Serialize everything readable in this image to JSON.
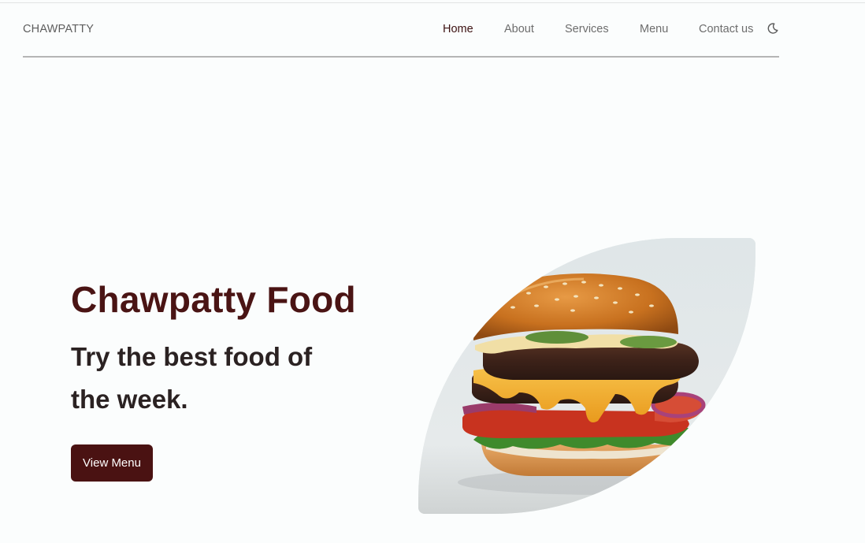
{
  "brand": {
    "logo": "CHAWPATTY",
    "accent_color": "#4a1212"
  },
  "nav": {
    "items": [
      {
        "label": "Home",
        "active": true
      },
      {
        "label": "About",
        "active": false
      },
      {
        "label": "Services",
        "active": false
      },
      {
        "label": "Menu",
        "active": false
      },
      {
        "label": "Contact us",
        "active": false
      }
    ],
    "theme_toggle_icon": "moon-icon"
  },
  "hero": {
    "title": "Chawpatty Food",
    "subtitle": "Try the best food of the week.",
    "button_label": "View Menu",
    "image_icon": "burger-photo"
  }
}
